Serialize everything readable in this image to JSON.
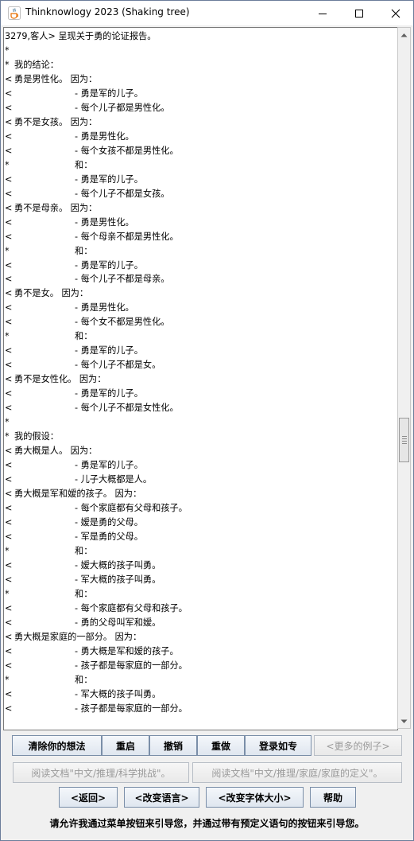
{
  "window": {
    "title": "Thinknowlogy 2023 (Shaking tree)"
  },
  "textarea": {
    "lines": [
      {
        "mark": "",
        "text": "3279,客人> 呈现关于勇的论证报告。",
        "indent": 0
      },
      {
        "mark": "*",
        "text": "",
        "indent": 0
      },
      {
        "mark": "*",
        "text": "我的结论：",
        "indent": 1
      },
      {
        "mark": "<",
        "text": "勇是男性化。 因为：",
        "indent": 1
      },
      {
        "mark": "<",
        "text": "- 勇是军的儿子。",
        "indent": 2
      },
      {
        "mark": "<",
        "text": "- 每个儿子都是男性化。",
        "indent": 2
      },
      {
        "mark": "<",
        "text": "勇不是女孩。 因为：",
        "indent": 1
      },
      {
        "mark": "<",
        "text": "- 勇是男性化。",
        "indent": 2
      },
      {
        "mark": "<",
        "text": "- 每个女孩不都是男性化。",
        "indent": 2
      },
      {
        "mark": "*",
        "text": "和：",
        "indent": 2
      },
      {
        "mark": "<",
        "text": "- 勇是军的儿子。",
        "indent": 2
      },
      {
        "mark": "<",
        "text": "- 每个儿子不都是女孩。",
        "indent": 2
      },
      {
        "mark": "<",
        "text": "勇不是母亲。 因为：",
        "indent": 1
      },
      {
        "mark": "<",
        "text": "- 勇是男性化。",
        "indent": 2
      },
      {
        "mark": "<",
        "text": "- 每个母亲不都是男性化。",
        "indent": 2
      },
      {
        "mark": "*",
        "text": "和：",
        "indent": 2
      },
      {
        "mark": "<",
        "text": "- 勇是军的儿子。",
        "indent": 2
      },
      {
        "mark": "<",
        "text": "- 每个儿子不都是母亲。",
        "indent": 2
      },
      {
        "mark": "<",
        "text": "勇不是女。 因为：",
        "indent": 1
      },
      {
        "mark": "<",
        "text": "- 勇是男性化。",
        "indent": 2
      },
      {
        "mark": "<",
        "text": "- 每个女不都是男性化。",
        "indent": 2
      },
      {
        "mark": "*",
        "text": "和：",
        "indent": 2
      },
      {
        "mark": "<",
        "text": "- 勇是军的儿子。",
        "indent": 2
      },
      {
        "mark": "<",
        "text": "- 每个儿子不都是女。",
        "indent": 2
      },
      {
        "mark": "<",
        "text": "勇不是女性化。 因为：",
        "indent": 1
      },
      {
        "mark": "<",
        "text": "- 勇是军的儿子。",
        "indent": 2
      },
      {
        "mark": "<",
        "text": "- 每个儿子不都是女性化。",
        "indent": 2
      },
      {
        "mark": "*",
        "text": "",
        "indent": 0
      },
      {
        "mark": "*",
        "text": "我的假设：",
        "indent": 1
      },
      {
        "mark": "<",
        "text": "勇大概是人。 因为：",
        "indent": 1
      },
      {
        "mark": "<",
        "text": "- 勇是军的儿子。",
        "indent": 2
      },
      {
        "mark": "<",
        "text": "- 儿子大概都是人。",
        "indent": 2
      },
      {
        "mark": "<",
        "text": "勇大概是军和嫒的孩子。 因为：",
        "indent": 1
      },
      {
        "mark": "<",
        "text": "- 每个家庭都有父母和孩子。",
        "indent": 2
      },
      {
        "mark": "<",
        "text": "- 嫒是勇的父母。",
        "indent": 2
      },
      {
        "mark": "<",
        "text": "- 军是勇的父母。",
        "indent": 2
      },
      {
        "mark": "*",
        "text": "和：",
        "indent": 2
      },
      {
        "mark": "<",
        "text": "- 嫒大概的孩子叫勇。",
        "indent": 2
      },
      {
        "mark": "<",
        "text": "- 军大概的孩子叫勇。",
        "indent": 2
      },
      {
        "mark": "*",
        "text": "和：",
        "indent": 2
      },
      {
        "mark": "<",
        "text": "- 每个家庭都有父母和孩子。",
        "indent": 2
      },
      {
        "mark": "<",
        "text": "- 勇的父母叫军和嫒。",
        "indent": 2
      },
      {
        "mark": "<",
        "text": "勇大概是家庭的一部分。 因为：",
        "indent": 1
      },
      {
        "mark": "<",
        "text": "- 勇大概是军和嫒的孩子。",
        "indent": 2
      },
      {
        "mark": "<",
        "text": "- 孩子都是每家庭的一部分。",
        "indent": 2
      },
      {
        "mark": "*",
        "text": "和：",
        "indent": 2
      },
      {
        "mark": "<",
        "text": "- 军大概的孩子叫勇。",
        "indent": 2
      },
      {
        "mark": "<",
        "text": "- 孩子都是每家庭的一部分。",
        "indent": 2
      },
      {
        "mark": "",
        "text": "",
        "indent": 0
      },
      {
        "mark": "<",
        "text": "",
        "indent": 0
      }
    ]
  },
  "buttons": {
    "clear": "清除你的想法",
    "restart": "重启",
    "undo": "撤销",
    "redo": "重做",
    "login": "登录如专",
    "more_examples": "<更多的例子>",
    "read_doc_1": "阅读文档\"中文/推理/科学挑战\"。",
    "read_doc_2": "阅读文档\"中文/推理/家庭/家庭的定义\"。",
    "back": "<返回>",
    "change_language": "<改变语言>",
    "change_font_size": "<改变字体大小>",
    "help": "帮助"
  },
  "hint": "请允许我通过菜单按钮来引导您，并通过带有预定义语句的按钮来引导您。",
  "icons": {
    "app": "java-cup-icon",
    "minimize": "minimize-icon",
    "maximize": "maximize-icon",
    "close": "close-icon",
    "scroll_up": "scroll-up-arrow-icon",
    "scroll_down": "scroll-down-arrow-icon"
  }
}
